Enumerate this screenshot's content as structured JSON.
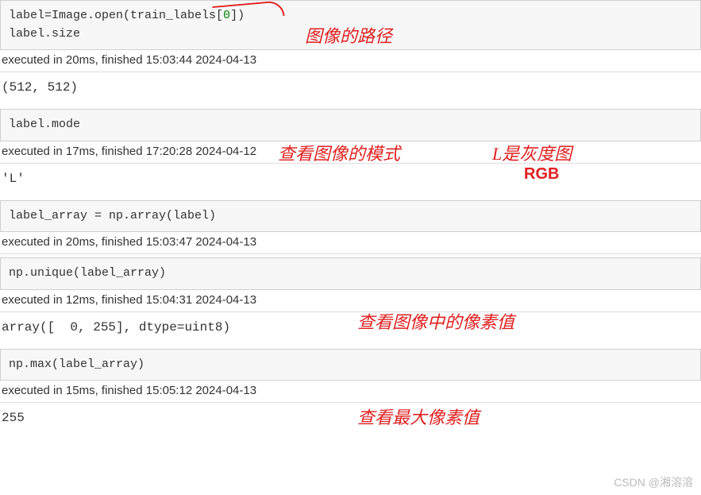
{
  "cells": [
    {
      "code_html": "label=Image.open(train_labels[<span class='num'>0</span>])\nlabel.size",
      "exec": "executed in 20ms, finished 15:03:44 2024-04-13",
      "output": "(512, 512)"
    },
    {
      "code_html": "label.mode",
      "exec": "executed in 17ms, finished 17:20:28 2024-04-12",
      "output": "'L'"
    },
    {
      "code_html": "label_array = np.array(label)",
      "exec": "executed in 20ms, finished 15:03:47 2024-04-13",
      "output": ""
    },
    {
      "code_html": "np.unique(label_array)",
      "exec": "executed in 12ms, finished 15:04:31 2024-04-13",
      "output": "array([  0, 255], dtype=uint8)"
    },
    {
      "code_html": "np.max(label_array)",
      "exec": "executed in 15ms, finished 15:05:12 2024-04-13",
      "output": "255"
    }
  ],
  "annotations": {
    "a1": "图像的路径",
    "a2": "查看图像的模式",
    "a3": "L是灰度图",
    "a4": "RGB",
    "a5": "查看图像中的像素值",
    "a6": "查看最大像素值"
  },
  "watermark": "CSDN @湘溶溶"
}
